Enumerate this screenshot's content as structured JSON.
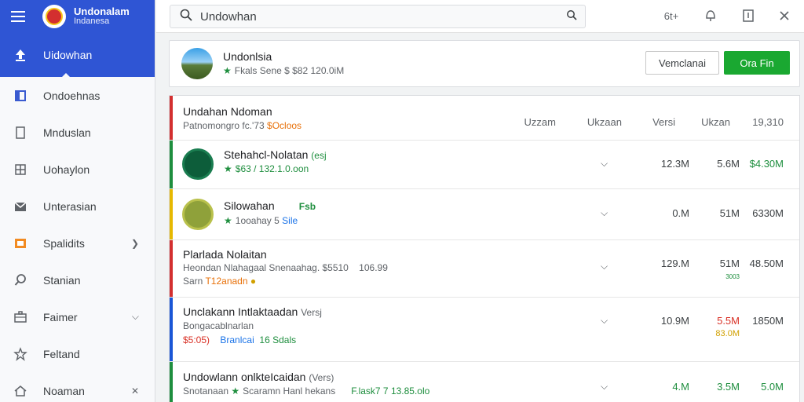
{
  "brand": {
    "title": "Undonalam",
    "subtitle": "Indanesa"
  },
  "sidebar": {
    "items": [
      {
        "label": "Uidowhan",
        "icon": "upload-icon"
      },
      {
        "label": "Ondoehnas",
        "icon": "bookmark-icon"
      },
      {
        "label": "Mnduslan",
        "icon": "document-icon"
      },
      {
        "label": "Uohaylon",
        "icon": "grid-icon"
      },
      {
        "label": "Unterasian",
        "icon": "mail-icon"
      },
      {
        "label": "Spalidits",
        "icon": "box-icon"
      },
      {
        "label": "Stanian",
        "icon": "search-icon"
      },
      {
        "label": "Faimer",
        "icon": "briefcase-icon"
      },
      {
        "label": "Feltand",
        "icon": "star-icon"
      },
      {
        "label": "Noaman",
        "icon": "home-icon"
      }
    ]
  },
  "search": {
    "value": "Undowhan"
  },
  "topbar": {
    "lang_label": "6t+"
  },
  "app": {
    "title": "Undonlsia",
    "subtitle": "Fkals  Sene $ $82 120.0iM",
    "btn_outline": "Vemclanai",
    "btn_primary": "Ora Fin"
  },
  "list": {
    "header": {
      "title": "Undahan Ndoman",
      "sub_a": "Patnomongro fc.'73 ",
      "sub_b": "$Ocloos",
      "col1": "Uzzam",
      "col2": "Ukzaan",
      "col3": "Versi",
      "col4": "Ukzan",
      "col5": "19,310"
    },
    "rows": [
      {
        "title": "Stehahcl-Nolatan",
        "title_tag": "(esj",
        "sub": "$63 / 132.1.0.oon",
        "c1": "12.3M",
        "c2": "5.6M",
        "c3": "$4.30M"
      },
      {
        "title": "Silowahan",
        "title_tag": "Fsb",
        "sub_a": "1ooahay 5 ",
        "sub_b": "Sile",
        "c1": "0.M",
        "c2": "51M",
        "c3": "6330M"
      },
      {
        "title": "Plarlada Nolaitan",
        "sub": "Heondan Nlahagaal Snenaahag.  $5510    106.99",
        "sub2_a": "Sarn ",
        "sub2_b": "T12anadn",
        "c1": "129.M",
        "c2": "51M",
        "c2_sub": "3003",
        "c3": "48.50M"
      },
      {
        "title": "Unclakann Intlaktaadan",
        "title_tag": "Versj",
        "sub": "Bongacablnarlan",
        "sub2_a": "$5:05)",
        "sub2_b": "Branlcai",
        "sub2_c": "16 Sdals",
        "c1": "10.9M",
        "c2": "5.5M",
        "c2_sub": "83.0M",
        "c3": "1850M"
      },
      {
        "title": "Undowlann onlkteIcaidan",
        "title_tag": "(Vers)",
        "sub_a": "Snotanaan",
        "sub_b": "Scaramn Hanl hekans",
        "sub_c": "F.lask7 7 13.85.olo",
        "c1": "4.M",
        "c2": "3.5M",
        "c3": "5.0M"
      }
    ]
  }
}
